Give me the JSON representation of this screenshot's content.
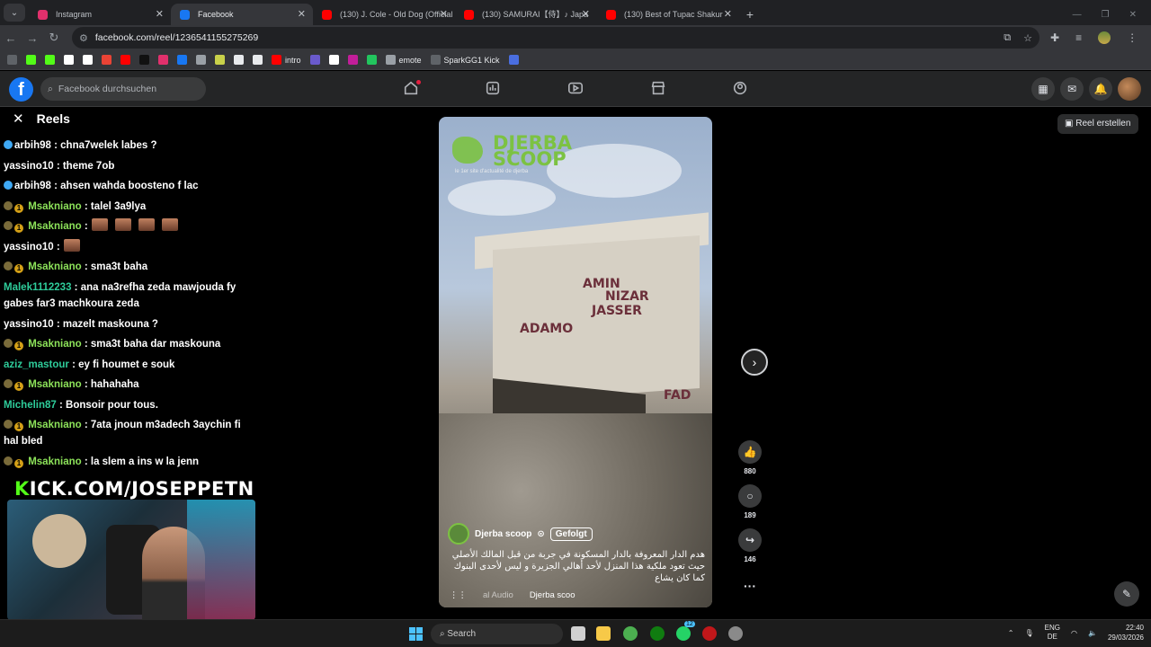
{
  "browser": {
    "tabs": [
      {
        "title": "Instagram",
        "active": false,
        "color": "#e1306c"
      },
      {
        "title": "Facebook",
        "active": true,
        "color": "#1877f2"
      },
      {
        "title": "(130) J. Cole - Old Dog (Official",
        "active": false,
        "color": "#ff0000"
      },
      {
        "title": "(130) SAMURAI【侍】♪ Japa",
        "active": false,
        "color": "#ff0000"
      },
      {
        "title": "(130) Best of Tupac Shakur",
        "active": false,
        "color": "#ff0000"
      }
    ],
    "url": "facebook.com/reel/1236541155275269",
    "bookmarks": [
      "intro",
      "emote",
      "SparkGG1 Kick"
    ]
  },
  "facebook": {
    "search_placeholder": "Facebook durchsuchen",
    "reels_title": "Reels",
    "create_reel": "Reel erstellen"
  },
  "chat": {
    "messages": [
      {
        "user": "arbih98",
        "text": ": chna7welek labes ?",
        "color": "#ffffff",
        "badges": [
          "b3"
        ]
      },
      {
        "user": "yassino10",
        "text": ": theme 7ob",
        "color": "#ffffff",
        "badges": []
      },
      {
        "user": "arbih98",
        "text": ": ahsen wahda boosteno f lac",
        "color": "#ffffff",
        "badges": [
          "b3"
        ]
      },
      {
        "user": "Msakniano",
        "text": ": talel 3a9lya",
        "color": "#8de35a",
        "badges": [
          "b1",
          "b2"
        ]
      },
      {
        "user": "Msakniano",
        "text": ":",
        "color": "#8de35a",
        "badges": [
          "b1",
          "b2"
        ],
        "emotes": 4
      },
      {
        "user": "yassino10",
        "text": ":",
        "color": "#ffffff",
        "badges": [],
        "emotes": 1
      },
      {
        "user": "Msakniano",
        "text": ": sma3t baha",
        "color": "#8de35a",
        "badges": [
          "b1",
          "b2"
        ]
      },
      {
        "user": "Malek1112233",
        "text": ": ana na3refha zeda mawjouda fy gabes far3 machkoura zeda",
        "color": "#2ecc9a",
        "badges": []
      },
      {
        "user": "yassino10",
        "text": ": mazelt maskouna ?",
        "color": "#ffffff",
        "badges": []
      },
      {
        "user": "Msakniano",
        "text": ": sma3t baha dar maskouna",
        "color": "#8de35a",
        "badges": [
          "b1",
          "b2"
        ]
      },
      {
        "user": "aziz_mastour",
        "text": ": ey fi houmet e souk",
        "color": "#2ecc9a",
        "badges": []
      },
      {
        "user": "Msakniano",
        "text": ": hahahaha",
        "color": "#8de35a",
        "badges": [
          "b1",
          "b2"
        ]
      },
      {
        "user": "Michelin87",
        "text": ": Bonsoir pour tous.",
        "color": "#2ecc9a",
        "badges": []
      },
      {
        "user": "Msakniano",
        "text": ": 7ata jnoun m3adech 3aychin fi hal bled",
        "color": "#8de35a",
        "badges": [
          "b1",
          "b2"
        ]
      },
      {
        "user": "Msakniano",
        "text": ": la slem a ins w la jenn",
        "color": "#8de35a",
        "badges": [
          "b1",
          "b2"
        ]
      }
    ],
    "kick_url_k": "K",
    "kick_url_rest": "ICK.COM/JOSEPPETN"
  },
  "reel": {
    "logo_line1": "DJERBA",
    "logo_line2": "SCOOP",
    "logo_tagline": "le 1er site d'actualité de djerba",
    "graffiti": [
      "AMIN",
      "NIZAR",
      "JASSER",
      "ADAMO",
      "FAD"
    ],
    "author": "Djerba scoop",
    "follow_label": "Gefolgt",
    "caption": "هدم الدار المعروفة بالدار المسكونة في جربة من قبل المالك الأصلي حيث تعود ملكية هذا المنزل لأحد أهالي الجزيرة و ليس لأحدى البنوك كما كان يشاع",
    "audio_label": "al Audio",
    "audio_source": "Djerba scoo",
    "likes": "880",
    "comments": "189",
    "shares": "146"
  },
  "taskbar": {
    "search_label": "Search",
    "lang_line1": "ENG",
    "lang_line2": "DE",
    "time": "22:40",
    "date": "29/03/2026",
    "whatsapp_badge": "12"
  }
}
